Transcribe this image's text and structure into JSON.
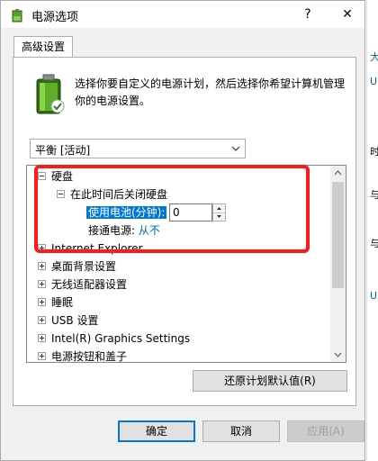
{
  "window": {
    "title": "电源选项",
    "help_label": "?",
    "close_label": "✕"
  },
  "tab": {
    "label": "高级设置"
  },
  "description": "选择你要自定义的电源计划，然后选择你希望计算机管理你的电源设置。",
  "plan_combo": {
    "value": "平衡 [活动]"
  },
  "tree": {
    "hard_disk": {
      "label": "硬盘",
      "expanded": true
    },
    "turn_off_after": {
      "label": "在此时间后关闭硬盘",
      "expanded": true
    },
    "on_battery": {
      "label": "使用电池(分钟):",
      "value": "0"
    },
    "plugged_in": {
      "label": "接通电源:",
      "value": "从不"
    },
    "items": [
      {
        "label": "Internet Explorer"
      },
      {
        "label": "桌面背景设置"
      },
      {
        "label": "无线适配器设置"
      },
      {
        "label": "睡眠"
      },
      {
        "label": "USB 设置"
      },
      {
        "label": "Intel(R) Graphics Settings"
      },
      {
        "label": "电源按钮和盖子"
      }
    ]
  },
  "restore_button": {
    "label": "还原计划默认值(R)"
  },
  "buttons": {
    "ok": "确定",
    "cancel": "取消",
    "apply": "应用(A)"
  },
  "colors": {
    "selection": "#0078d7",
    "link": "#0066cc",
    "annotation": "#ff1a1a"
  }
}
